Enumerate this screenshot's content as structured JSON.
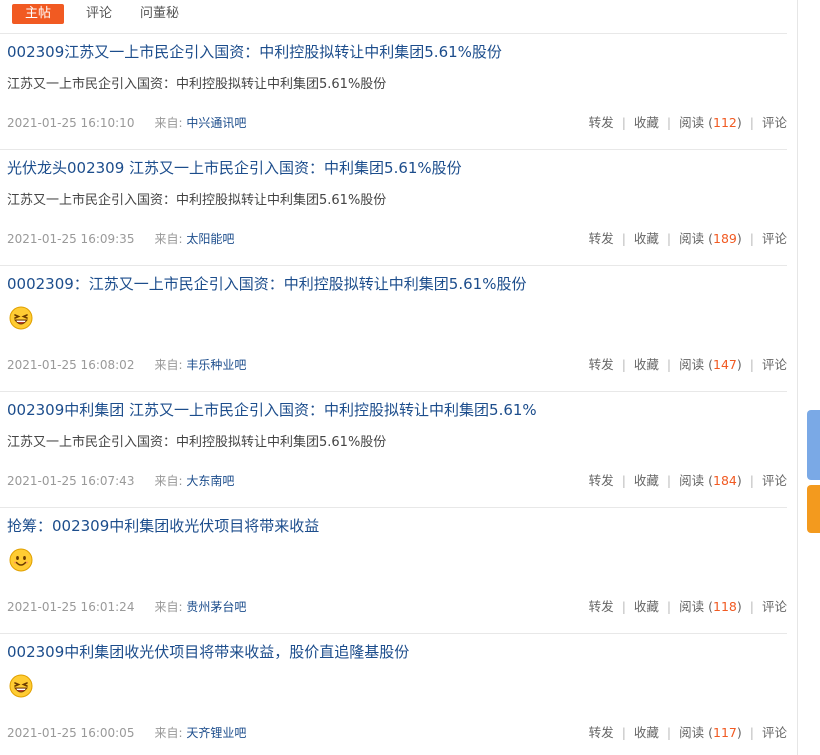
{
  "tabs": [
    {
      "label": "主帖",
      "active": true
    },
    {
      "label": "评论",
      "active": false
    },
    {
      "label": "问董秘",
      "active": false
    }
  ],
  "posts": [
    {
      "title": "002309江苏又一上市民企引入国资：中利控股拟转让中利集团5.61%股份",
      "summary": "江苏又一上市民企引入国资：中利控股拟转让中利集团5.61%股份",
      "emoji": null,
      "time": "2021-01-25 16:10:10",
      "source_label": "来自:",
      "source": "中兴通讯吧",
      "read_count": "112"
    },
    {
      "title": "光伏龙头002309 江苏又一上市民企引入国资：中利集团5.61%股份",
      "summary": "江苏又一上市民企引入国资：中利控股拟转让中利集团5.61%股份",
      "emoji": null,
      "time": "2021-01-25 16:09:35",
      "source_label": "来自:",
      "source": "太阳能吧",
      "read_count": "189"
    },
    {
      "title": "0002309：江苏又一上市民企引入国资：中利控股拟转让中利集团5.61%股份",
      "summary": "",
      "emoji": "laughing-emoji",
      "time": "2021-01-25 16:08:02",
      "source_label": "来自:",
      "source": "丰乐种业吧",
      "read_count": "147"
    },
    {
      "title": "002309中利集团 江苏又一上市民企引入国资：中利控股拟转让中利集团5.61%",
      "summary": "江苏又一上市民企引入国资：中利控股拟转让中利集团5.61%股份",
      "emoji": null,
      "time": "2021-01-25 16:07:43",
      "source_label": "来自:",
      "source": "大东南吧",
      "read_count": "184"
    },
    {
      "title": "抢筹：002309中利集团收光伏项目将带来收益",
      "summary": "",
      "emoji": "smile-emoji",
      "time": "2021-01-25 16:01:24",
      "source_label": "来自:",
      "source": "贵州茅台吧",
      "read_count": "118"
    },
    {
      "title": "002309中利集团收光伏项目将带来收益，股价直追隆基股份",
      "summary": "",
      "emoji": "laughing-emoji",
      "time": "2021-01-25 16:00:05",
      "source_label": "来自:",
      "source": "天齐锂业吧",
      "read_count": "117"
    }
  ],
  "actions": {
    "forward": "转发",
    "favorite": "收藏",
    "read": "阅读",
    "comment": "评论",
    "separator": "|"
  },
  "colors": {
    "accent": "#f15a22",
    "link": "#1c4d8c",
    "float_blue": "#7aa9e6",
    "float_orange": "#f39a1e"
  }
}
